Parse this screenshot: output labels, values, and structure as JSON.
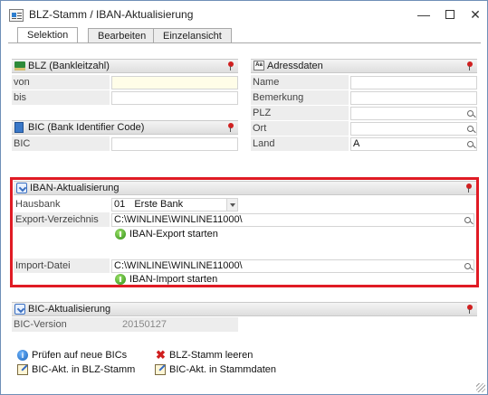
{
  "window": {
    "title": "BLZ-Stamm / IBAN-Aktualisierung",
    "minimize": "—",
    "close": "✕"
  },
  "tabs": [
    {
      "label": "Selektion",
      "active": true
    },
    {
      "label": "Bearbeiten",
      "active": false
    },
    {
      "label": "Einzelansicht",
      "active": false
    }
  ],
  "blz": {
    "title": "BLZ (Bankleitzahl)",
    "von_label": "von",
    "von_value": "",
    "bis_label": "bis",
    "bis_value": ""
  },
  "bic_panel": {
    "title": "BIC (Bank Identifier Code)",
    "bic_label": "BIC",
    "bic_value": ""
  },
  "adress": {
    "title": "Adressdaten",
    "icon_text": "Aa",
    "name_label": "Name",
    "name_value": "",
    "bemerkung_label": "Bemerkung",
    "bemerkung_value": "",
    "plz_label": "PLZ",
    "plz_value": "",
    "ort_label": "Ort",
    "ort_value": "",
    "land_label": "Land",
    "land_value": "A"
  },
  "iban": {
    "title": "IBAN-Aktualisierung",
    "hausbank_label": "Hausbank",
    "hausbank_code": "01",
    "hausbank_name": "Erste Bank",
    "export_label": "Export-Verzeichnis",
    "export_value": "C:\\WINLINE\\WINLINE11000\\",
    "export_action": "IBAN-Export starten",
    "import_label": "Import-Datei",
    "import_value": "C:\\WINLINE\\WINLINE11000\\",
    "import_action": "IBAN-Import starten"
  },
  "bic_akt": {
    "title": "BIC-Aktualisierung",
    "version_label": "BIC-Version",
    "version_value": "20150127",
    "actions": {
      "check": "Prüfen auf neue BICs",
      "clear": "BLZ-Stamm leeren",
      "akt_blz": "BIC-Akt. in BLZ-Stamm",
      "akt_stamm": "BIC-Akt. in Stammdaten"
    }
  },
  "colors": {
    "highlight_frame": "#e01b24",
    "header_bg": "#dedede",
    "label_bg": "#ededed",
    "required_field": "#fffde8"
  }
}
